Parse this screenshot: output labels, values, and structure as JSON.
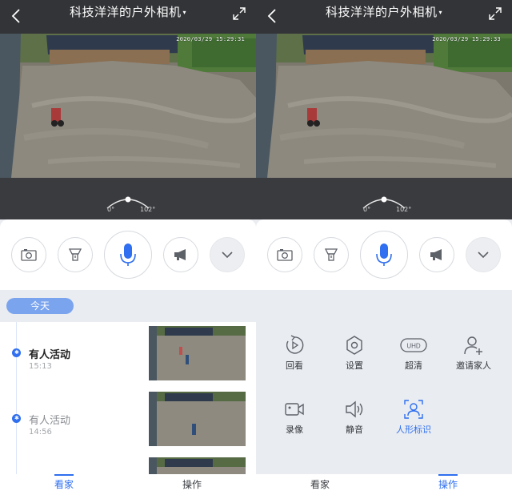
{
  "left_panel": {
    "header": {
      "title": "科技洋洋的户外相机",
      "caret": "▾"
    },
    "video": {
      "timestamp": "2020/03/29 15:29:31"
    },
    "dial": {
      "min_label": "0°",
      "max_label": "102°"
    },
    "controls": [
      "snapshot",
      "spotlight",
      "talk",
      "speaker",
      "more"
    ],
    "timeline": {
      "date_chip": "今天",
      "events": [
        {
          "title": "有人活动",
          "time": "15:13"
        },
        {
          "title": "有人活动",
          "time": "14:56"
        }
      ]
    },
    "tabs": [
      {
        "label": "看家"
      },
      {
        "label": "操作"
      }
    ],
    "active_tab": 0
  },
  "right_panel": {
    "header": {
      "title": "科技洋洋的户外相机",
      "caret": "▾"
    },
    "video": {
      "timestamp": "2020/03/29 15:29:33"
    },
    "dial": {
      "min_label": "0°",
      "max_label": "102°"
    },
    "operations": {
      "row1": [
        {
          "label": "回看",
          "icon": "playback-icon"
        },
        {
          "label": "设置",
          "icon": "settings-icon"
        },
        {
          "label": "超清",
          "icon": "uhd-icon",
          "badge": "UHD"
        },
        {
          "label": "邀请家人",
          "icon": "invite-family-icon"
        }
      ],
      "row2": [
        {
          "label": "录像",
          "icon": "record-icon"
        },
        {
          "label": "静音",
          "icon": "mute-icon"
        },
        {
          "label": "人形标识",
          "icon": "human-detection-icon",
          "active": true
        }
      ]
    },
    "tabs": [
      {
        "label": "看家"
      },
      {
        "label": "操作"
      }
    ],
    "active_tab": 1
  },
  "colors": {
    "accent": "#2f6ff0",
    "header_bg": "#333437",
    "panel_bg": "#e9ecf1",
    "chip": "#7aa4ee"
  }
}
